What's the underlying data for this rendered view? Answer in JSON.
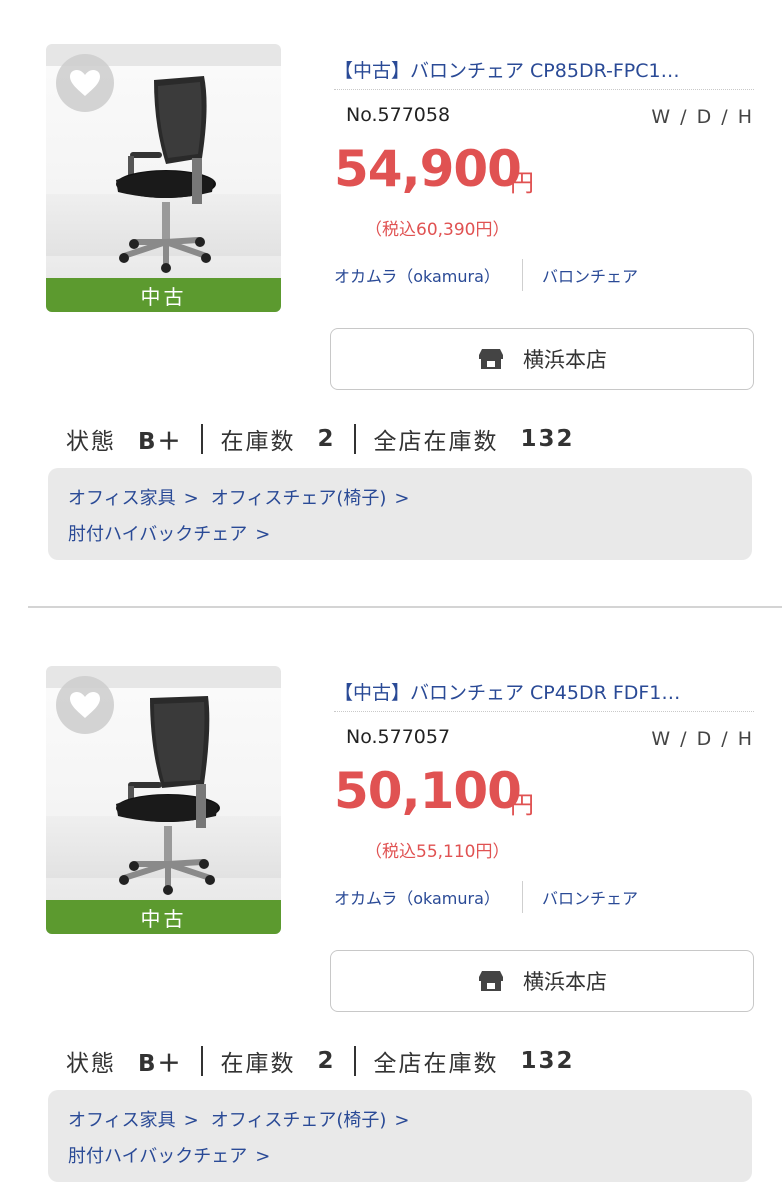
{
  "products": [
    {
      "title": "【中古】バロンチェア CP85DR-FPC1…",
      "item_no": "No.577058",
      "dims_label": "W / D / H",
      "price": "54,900",
      "currency": "円",
      "tax_included": "（税込60,390円）",
      "maker": "オカムラ（okamura）",
      "series": "バロンチェア",
      "store_label": "横浜本店",
      "condition_badge": "中古",
      "status": {
        "condition_label": "状態",
        "condition_value": "B＋",
        "stock_label": "在庫数",
        "stock_value": "2",
        "all_stock_label": "全店在庫数",
        "all_stock_value": "132"
      },
      "breadcrumbs": {
        "cat1": "オフィス家具",
        "cat2": "オフィスチェア(椅子)",
        "cat3": "肘付ハイバックチェア",
        "chevron": ">"
      }
    },
    {
      "title": "【中古】バロンチェア CP45DR FDF1…",
      "item_no": "No.577057",
      "dims_label": "W / D / H",
      "price": "50,100",
      "currency": "円",
      "tax_included": "（税込55,110円）",
      "maker": "オカムラ（okamura）",
      "series": "バロンチェア",
      "store_label": "横浜本店",
      "condition_badge": "中古",
      "status": {
        "condition_label": "状態",
        "condition_value": "B＋",
        "stock_label": "在庫数",
        "stock_value": "2",
        "all_stock_label": "全店在庫数",
        "all_stock_value": "132"
      },
      "breadcrumbs": {
        "cat1": "オフィス家具",
        "cat2": "オフィスチェア(椅子)",
        "cat3": "肘付ハイバックチェア",
        "chevron": ">"
      }
    }
  ],
  "icons": {
    "favorite": "heart-icon",
    "store": "store-icon"
  },
  "colors": {
    "price": "#e05252",
    "link": "#2a4a96",
    "badge": "#5c9a2f",
    "breadcrumb_bg": "#e9e9e9"
  }
}
